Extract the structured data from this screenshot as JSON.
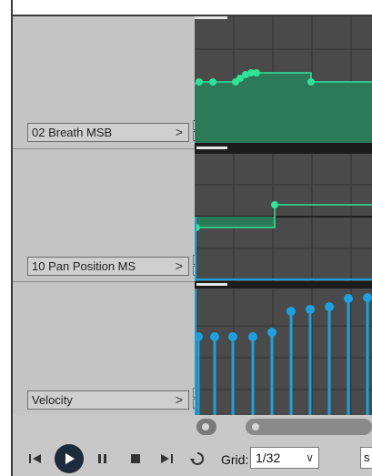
{
  "lanes": [
    {
      "label": "02 Breath MSB",
      "chevron": ">",
      "collapse": "−",
      "expand": "+",
      "kind": "envelope",
      "color": "#2fe39b"
    },
    {
      "label": "10 Pan Position MS",
      "chevron": ">",
      "collapse": "−",
      "expand": "+",
      "kind": "envelope",
      "color": "#2fe39b"
    },
    {
      "label": "Velocity",
      "chevron": ">",
      "collapse": "−",
      "expand": "+",
      "kind": "velocity",
      "color": "#1aa2e0"
    }
  ],
  "scrollbar": {
    "left_arrow_icon": "scroll-left-icon"
  },
  "transport": {
    "icons": [
      "skip-to-start-icon",
      "play-icon",
      "pause-icon",
      "stop-icon",
      "skip-to-end-icon",
      "loop-icon"
    ],
    "grid_label": "Grid:",
    "grid_value": "1/32",
    "grid_dropdown_icon": "chevron-down-icon",
    "next_field_text": "s"
  },
  "colors": {
    "lane_background": "#4a4a4a",
    "envelope_line": "#2fe39b",
    "envelope_fill": "#2d7a58",
    "velocity": "#1aa2e0",
    "label_column": "#c4c4c4",
    "transport": "#c8c8c8"
  }
}
